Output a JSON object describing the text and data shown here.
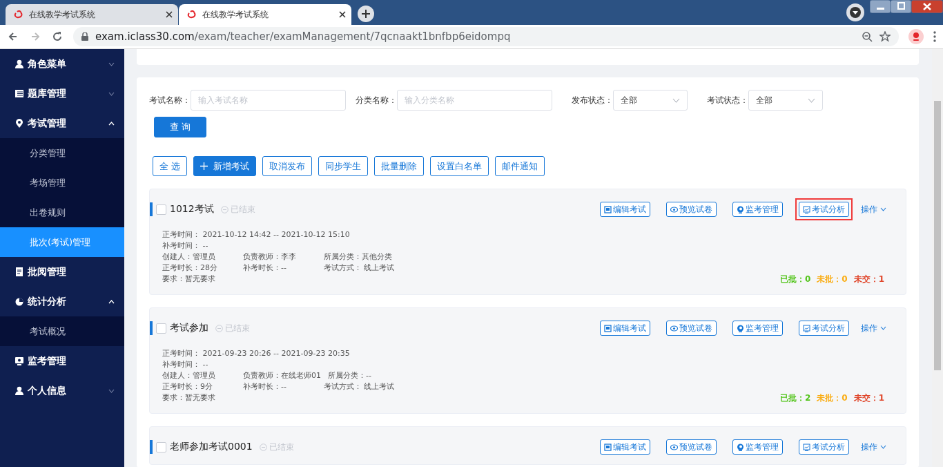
{
  "browser": {
    "tabs": [
      {
        "title": "在线教学考试系统",
        "selected": false
      },
      {
        "title": "在线教学考试系统",
        "selected": true
      }
    ],
    "url_host": "exam.iclass30.com",
    "url_path": "/exam/teacher/examManagement/7qcnaakt1bnfbp6eidompq"
  },
  "sidebar": {
    "items": [
      {
        "label": "角色菜单",
        "kind": "user",
        "expanded": false
      },
      {
        "label": "题库管理",
        "kind": "list",
        "expanded": false
      },
      {
        "label": "考试管理",
        "kind": "pin",
        "expanded": true,
        "children": [
          {
            "label": "分类管理",
            "selected": false
          },
          {
            "label": "考场管理",
            "selected": false
          },
          {
            "label": "出卷规则",
            "selected": false
          },
          {
            "label": "批次(考试)管理",
            "selected": true
          }
        ]
      },
      {
        "label": "批阅管理",
        "kind": "doc"
      },
      {
        "label": "统计分析",
        "kind": "pie",
        "expanded": true,
        "children": [
          {
            "label": "考试概况",
            "selected": false
          }
        ]
      },
      {
        "label": "监考管理",
        "kind": "monitor"
      },
      {
        "label": "个人信息",
        "kind": "user",
        "expanded": false
      }
    ]
  },
  "filters": [
    {
      "label": "考试名称：",
      "kind": "text",
      "placeholder": "输入考试名称"
    },
    {
      "label": "分类名称：",
      "kind": "text",
      "placeholder": "输入分类名称"
    },
    {
      "label": "发布状态：",
      "kind": "select",
      "value": "全部"
    },
    {
      "label": "考试状态：",
      "kind": "select",
      "value": "全部"
    }
  ],
  "search_button": "查 询",
  "toolbar": [
    {
      "label": "全 选",
      "kind": "outline"
    },
    {
      "label": "新增考试",
      "kind": "primary"
    },
    {
      "label": "取消发布",
      "kind": "outline"
    },
    {
      "label": "同步学生",
      "kind": "outline"
    },
    {
      "label": "批量删除",
      "kind": "outline"
    },
    {
      "label": "设置白名单",
      "kind": "outline"
    },
    {
      "label": "邮件通知",
      "kind": "outline"
    }
  ],
  "exams": [
    {
      "title": "1012考试",
      "status": "已结束",
      "checked": false,
      "details": [
        [
          "正考时间： 2021-10-12 14:42 -- 2021-10-12 15:10"
        ],
        [
          "补考时间： --"
        ],
        [
          "创建人：管理员",
          "负责教师：李李",
          "所属分类：其他分类"
        ],
        [
          "正考时长：28分",
          "补考时长：--",
          "考试方式： 线上考试"
        ],
        [
          "要求：暂无要求"
        ]
      ],
      "actions": [
        {
          "label": "编辑考试",
          "highlighted": false
        },
        {
          "label": "预览试卷",
          "highlighted": false
        },
        {
          "label": "监考管理",
          "highlighted": false
        },
        {
          "label": "考试分析",
          "highlighted": true
        }
      ],
      "menu": "操作",
      "stats": [
        {
          "label": "已批：0",
          "color": "#52c41a"
        },
        {
          "label": "未批：0",
          "color": "#faad14"
        },
        {
          "label": "未交：1",
          "color": "#e0462b"
        }
      ]
    },
    {
      "title": "考试参加",
      "status": "已结束",
      "checked": false,
      "details": [
        [
          "正考时间： 2021-09-23 20:26 -- 2021-09-23 20:35"
        ],
        [
          "补考时间： --"
        ],
        [
          "创建人：管理员",
          "负责教师：在线老师01",
          "所属分类：--"
        ],
        [
          "正考时长：9分",
          "补考时长：--",
          "考试方式： 线上考试"
        ],
        [
          "要求：暂无要求"
        ]
      ],
      "actions": [
        {
          "label": "编辑考试",
          "highlighted": false
        },
        {
          "label": "预览试卷",
          "highlighted": false
        },
        {
          "label": "监考管理",
          "highlighted": false
        },
        {
          "label": "考试分析",
          "highlighted": false
        }
      ],
      "menu": "操作",
      "stats": [
        {
          "label": "已批：2",
          "color": "#52c41a"
        },
        {
          "label": "未批：0",
          "color": "#faad14"
        },
        {
          "label": "未交：1",
          "color": "#e0462b"
        }
      ]
    },
    {
      "title": "老师参加考试0001",
      "status": "已结束",
      "checked": false,
      "actions": [
        {
          "label": "编辑考试",
          "highlighted": false
        },
        {
          "label": "预览试卷",
          "highlighted": false
        },
        {
          "label": "监考管理",
          "highlighted": false
        },
        {
          "label": "考试分析",
          "highlighted": false
        }
      ],
      "menu": "操作"
    }
  ]
}
